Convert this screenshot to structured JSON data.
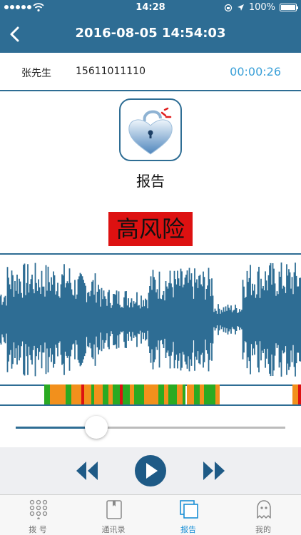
{
  "status_bar": {
    "time": "14:28",
    "battery": "100%"
  },
  "nav": {
    "title": "2016-08-05 14:54:03"
  },
  "call": {
    "name": "张先生",
    "phone": "15611011110",
    "duration": "00:00:26"
  },
  "report": {
    "label": "报告",
    "risk_level": "高风险"
  },
  "playback": {
    "progress": 0.3
  },
  "tabs": [
    {
      "label": "拨  号",
      "icon": "keypad-icon",
      "active": false
    },
    {
      "label": "通讯录",
      "icon": "contacts-book-icon",
      "active": false
    },
    {
      "label": "报告",
      "icon": "report-icon",
      "active": true
    },
    {
      "label": "我的",
      "icon": "ghost-profile-icon",
      "active": false
    }
  ],
  "colors": {
    "primary": "#2e6d94",
    "accent": "#3aa0d8",
    "risk_red": "#dd1111",
    "tab_active": "#1a8fd6",
    "strip_green": "#2aaa22",
    "strip_orange": "#f2901c"
  }
}
